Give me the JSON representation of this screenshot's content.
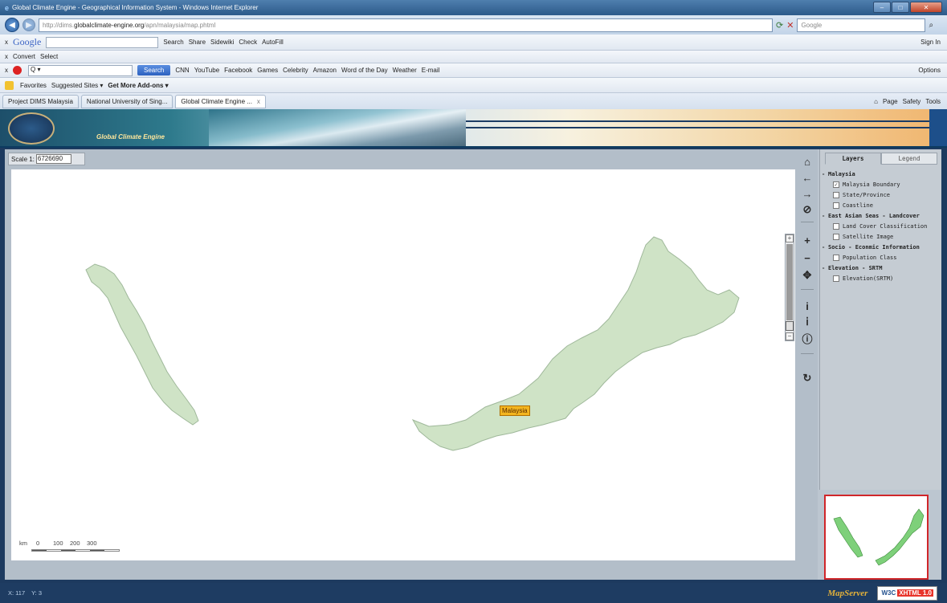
{
  "window": {
    "title": "Global Climate Engine - Geographical Information System - Windows Internet Explorer"
  },
  "address": {
    "prefix": "http://dims.",
    "host": "globalclimate-engine.org",
    "path": "/apn/malaysia/map.phtml",
    "search_box": "Google"
  },
  "google_toolbar": {
    "logo": "Google",
    "items": [
      "Search",
      "Share",
      "Sidewiki",
      "Check",
      "AutoFill"
    ],
    "sign_in": "Sign In"
  },
  "convert_toolbar": {
    "convert": "Convert",
    "select": "Select"
  },
  "search_toolbar": {
    "input_value": "Q ▾",
    "search_button": "Search",
    "items": [
      "CNN",
      "YouTube",
      "Facebook",
      "Games",
      "Celebrity",
      "Amazon",
      "Word of the Day",
      "Weather",
      "E-mail"
    ],
    "options": "Options"
  },
  "favorites_bar": {
    "favorites": "Favorites",
    "suggested": "Suggested Sites ▾",
    "addons": "Get More Add-ons ▾"
  },
  "tabs": [
    {
      "label": "Project DIMS Malaysia"
    },
    {
      "label": "National University of Sing..."
    },
    {
      "label": "Global Climate Engine ..."
    }
  ],
  "command_bar": {
    "page": "Page",
    "safety": "Safety",
    "tools": "Tools"
  },
  "banner": {
    "text": "Global Climate Engine"
  },
  "map": {
    "scale_label": "Scale 1:",
    "scale_value": "6726690",
    "feature_label": "Malaysia",
    "scalebar": {
      "unit": "km",
      "ticks": [
        "0",
        "100",
        "200",
        "300"
      ]
    }
  },
  "layers_panel": {
    "tab_layers": "Layers",
    "tab_legend": "Legend",
    "groups": [
      {
        "name": "Malaysia",
        "layers": [
          {
            "name": "Malaysia Boundary",
            "checked": true
          },
          {
            "name": "State/Province",
            "checked": false
          },
          {
            "name": "Coastline",
            "checked": false
          }
        ]
      },
      {
        "name": "East Asian Seas - Landcover",
        "layers": [
          {
            "name": "Land Cover Classification",
            "checked": false
          },
          {
            "name": "Satellite Image",
            "checked": false
          }
        ]
      },
      {
        "name": "Socio - Econmic Information",
        "layers": [
          {
            "name": "Population Class",
            "checked": false
          }
        ]
      },
      {
        "name": "Elevation - SRTM",
        "layers": [
          {
            "name": "Elevation(SRTM)",
            "checked": false
          }
        ]
      }
    ]
  },
  "status": {
    "x": "X: 117",
    "y": "Y: 3",
    "mapserver": "MapServer",
    "w3c": "W3C",
    "xhtml": "XHTML 1.0"
  },
  "colors": {
    "land": "#cfe3c6",
    "land_stroke": "#9fb89a",
    "label_bg": "#f3b51f",
    "overview_border": "#d0262a"
  }
}
